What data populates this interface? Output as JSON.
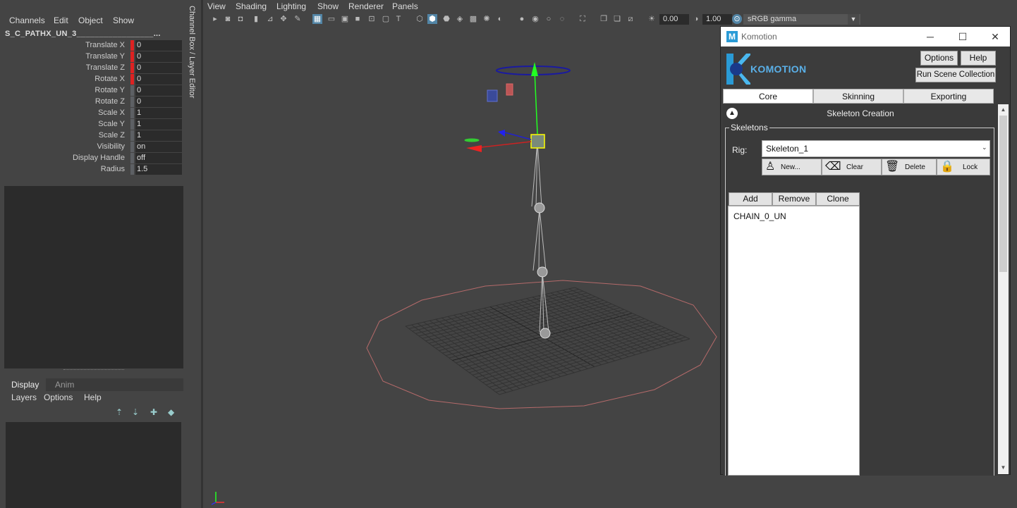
{
  "channel_box": {
    "menu": [
      "Channels",
      "Edit",
      "Object",
      "Show"
    ],
    "node_name": "S_C_PATHX_UN_3_________________...",
    "attributes": [
      {
        "label": "Translate X",
        "value": "0",
        "keyed": true
      },
      {
        "label": "Translate Y",
        "value": "0",
        "keyed": true
      },
      {
        "label": "Translate Z",
        "value": "0",
        "keyed": true
      },
      {
        "label": "Rotate X",
        "value": "0",
        "keyed": true
      },
      {
        "label": "Rotate Y",
        "value": "0",
        "keyed": false
      },
      {
        "label": "Rotate Z",
        "value": "0",
        "keyed": false
      },
      {
        "label": "Scale X",
        "value": "1",
        "keyed": false
      },
      {
        "label": "Scale Y",
        "value": "1",
        "keyed": false
      },
      {
        "label": "Scale Z",
        "value": "1",
        "keyed": false
      },
      {
        "label": "Visibility",
        "value": "on",
        "keyed": false
      },
      {
        "label": "Display Handle",
        "value": "off",
        "keyed": false
      },
      {
        "label": "Radius",
        "value": "1.5",
        "keyed": false
      }
    ],
    "vertical_tab": "Channel Box / Layer Editor"
  },
  "layer_editor": {
    "tabs": [
      "Display",
      "Anim"
    ],
    "menu": [
      "Layers",
      "Options",
      "Help"
    ]
  },
  "viewport": {
    "menu": [
      "View",
      "Shading",
      "Lighting",
      "Show",
      "Renderer",
      "Panels"
    ],
    "exposure": "0.00",
    "gamma": "1.00",
    "color_space": "sRGB gamma"
  },
  "komotion": {
    "window_title": "Komotion",
    "app_icon_letter": "M",
    "logo_text": "KOMOTION",
    "options_label": "Options",
    "help_label": "Help",
    "run_label": "Run Scene Collection",
    "tabs": [
      "Core",
      "Skinning",
      "Exporting"
    ],
    "active_tab": "Core",
    "section_title": "Skeleton Creation",
    "group_label": "Skeletons",
    "rig_label": "Rig:",
    "rig_value": "Skeleton_1",
    "actions": [
      {
        "label": "New...",
        "icon": "person-icon"
      },
      {
        "label": "Clear",
        "icon": "clear-icon"
      },
      {
        "label": "Delete",
        "icon": "trash-icon"
      },
      {
        "label": "Lock",
        "icon": "lock-icon"
      }
    ],
    "chain_buttons": [
      "Add",
      "Remove",
      "Clone"
    ],
    "chains": [
      "CHAIN_0_UN"
    ],
    "accent_color": "#2a9bd6"
  }
}
